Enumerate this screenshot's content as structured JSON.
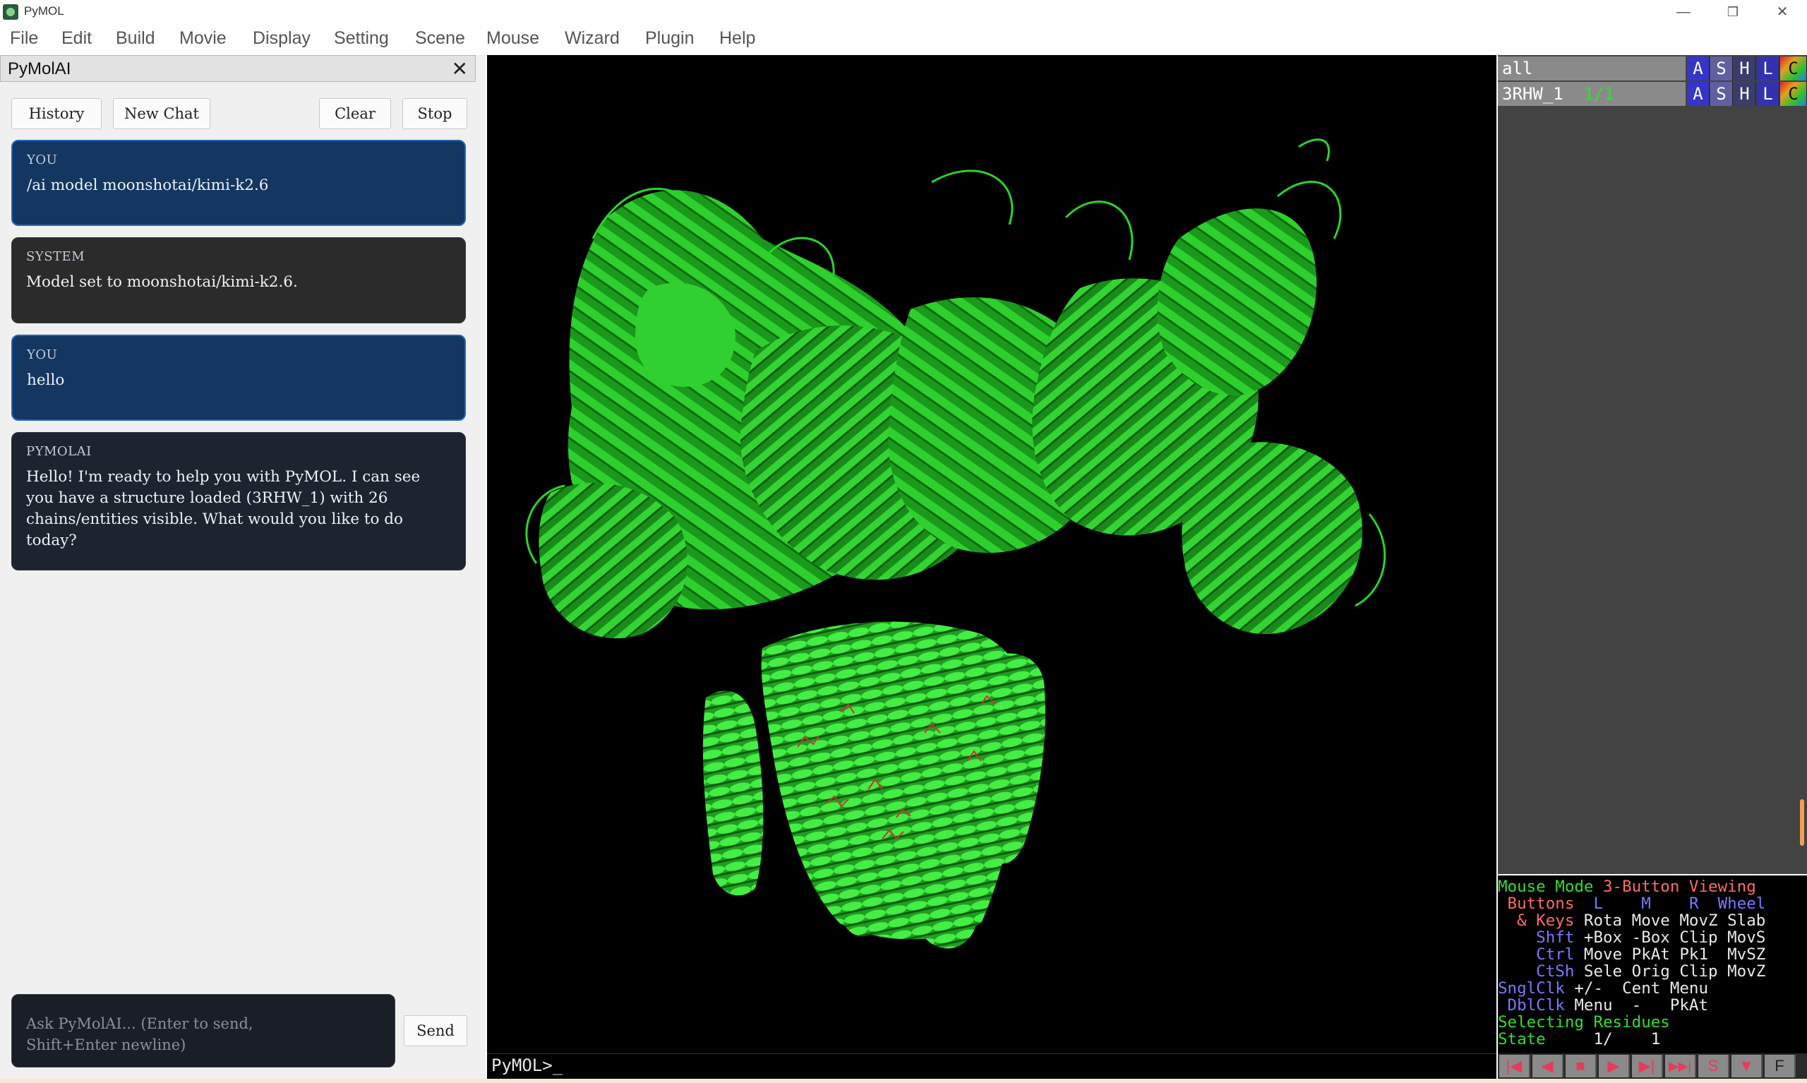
{
  "window": {
    "title": "PyMOL",
    "min": "—",
    "restore": "❐",
    "close": "✕"
  },
  "menubar": {
    "items": [
      "File",
      "Edit",
      "Build",
      "Movie",
      "Display",
      "Setting",
      "Scene",
      "Mouse",
      "Wizard",
      "Plugin",
      "Help"
    ]
  },
  "panel": {
    "title": "PyMolAI",
    "close": "✕",
    "buttons": {
      "history": "History",
      "new_chat": "New Chat",
      "clear": "Clear",
      "stop": "Stop"
    },
    "messages": [
      {
        "role": "YOU",
        "text": "/ai model moonshotai/kimi-k2.6"
      },
      {
        "role": "SYSTEM",
        "text": "Model set to moonshotai/kimi-k2.6."
      },
      {
        "role": "YOU",
        "text": "hello"
      },
      {
        "role": "PYMOLAI",
        "text": "Hello! I'm ready to help you with PyMOL. I can see\nyou have a structure loaded (3RHW_1) with 26\nchains/entities visible. What would you like to do\ntoday?"
      }
    ],
    "input_placeholder": "Ask PyMolAI... (Enter to send,\nShift+Enter newline)",
    "send": "Send"
  },
  "viewer": {
    "prompt": "PyMOL>_",
    "cartoon_color": "#22cc22",
    "ligand_color": "#cc3333"
  },
  "objects": [
    {
      "name": "all",
      "state": "",
      "buttons": [
        "A",
        "S",
        "H",
        "L",
        "C"
      ]
    },
    {
      "name": "3RHW_1",
      "state": "1/1",
      "buttons": [
        "A",
        "S",
        "H",
        "L",
        "C"
      ]
    }
  ],
  "mouse_mode": {
    "header_label": "Mouse Mode ",
    "header_mode": "3-Button Viewing",
    "buttons_label": " Buttons",
    "cols": [
      "L",
      "M",
      "R",
      "Wheel"
    ],
    "keys_label": "  & Keys",
    "keys_row": "Rota Move MovZ Slab",
    "shft_label": "    Shft",
    "shft_row": "+Box -Box Clip MovS",
    "ctrl_label": "    Ctrl",
    "ctrl_row": "Move PkAt Pk1  MvSZ",
    "ctsh_label": "    CtSh",
    "ctsh_row": "Sele Orig Clip MovZ",
    "sngl_label": "SnglClk",
    "sngl_row": "+/-  Cent Menu",
    "dbl_label": " DblClk",
    "dbl_row": "Menu  -   PkAt",
    "selecting": "Selecting Residues",
    "state_label": "State",
    "state_value": "1/    1"
  },
  "playback": [
    "|◀",
    "◀",
    "■",
    "▶",
    "▶|",
    "▶▶|",
    "S",
    "▼",
    "F"
  ]
}
